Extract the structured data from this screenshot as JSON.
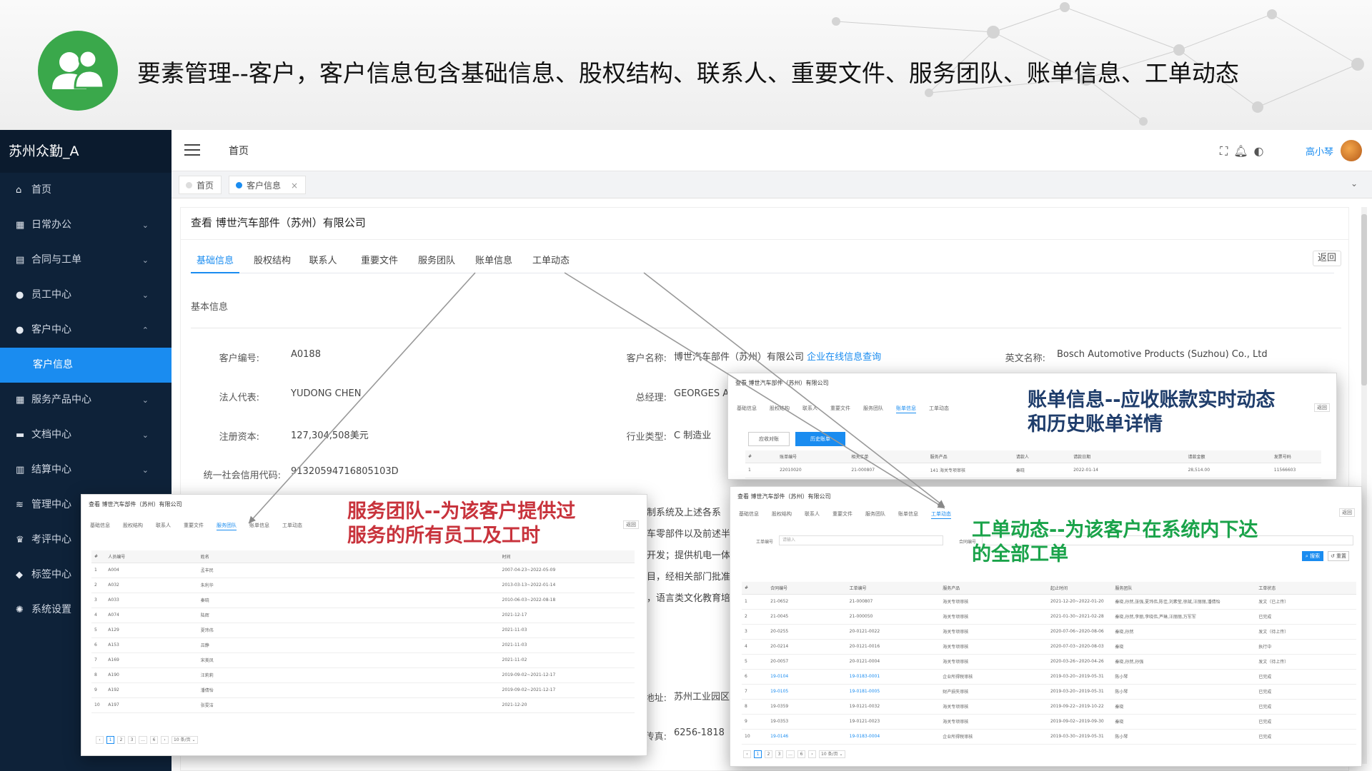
{
  "slide": {
    "title": "要素管理--客户，客户信息包含基础信息、股权结构、联系人、重要文件、服务团队、账单信息、工单动态",
    "logo_icon": "users-icon",
    "accent": "#3aa84b"
  },
  "app": {
    "brand": "苏州众勤_A",
    "home": "首页",
    "user": "高小琴",
    "icons": [
      "fullscreen-icon",
      "bell-icon",
      "theme-icon"
    ]
  },
  "sidebar": {
    "items": [
      {
        "icon": "home-icon",
        "glyph": "⌂",
        "label": "首页",
        "chevron": ""
      },
      {
        "icon": "briefcase-icon",
        "glyph": "▦",
        "label": "日常办公",
        "chevron": "⌄"
      },
      {
        "icon": "document-icon",
        "glyph": "▤",
        "label": "合同与工单",
        "chevron": "⌄"
      },
      {
        "icon": "user-icon",
        "glyph": "●",
        "label": "员工中心",
        "chevron": "⌄"
      },
      {
        "icon": "user-icon",
        "glyph": "●",
        "label": "客户中心",
        "chevron": "⌃"
      },
      {
        "icon": "",
        "glyph": "",
        "label": "客户信息",
        "chevron": ""
      },
      {
        "icon": "grid-icon",
        "glyph": "▦",
        "label": "服务产品中心",
        "chevron": "⌄"
      },
      {
        "icon": "folder-icon",
        "glyph": "▬",
        "label": "文档中心",
        "chevron": "⌄"
      },
      {
        "icon": "calculator-icon",
        "glyph": "▥",
        "label": "结算中心",
        "chevron": "⌄"
      },
      {
        "icon": "layers-icon",
        "glyph": "≋",
        "label": "管理中心",
        "chevron": ""
      },
      {
        "icon": "trophy-icon",
        "glyph": "♛",
        "label": "考评中心",
        "chevron": ""
      },
      {
        "icon": "tag-icon",
        "glyph": "◆",
        "label": "标签中心",
        "chevron": ""
      },
      {
        "icon": "gear-icon",
        "glyph": "✺",
        "label": "系统设置",
        "chevron": ""
      }
    ]
  },
  "page_tabs": [
    {
      "label": "首页",
      "close": ""
    },
    {
      "label": "客户信息",
      "close": "×"
    }
  ],
  "page": {
    "heading": "查看 博世汽车部件（苏州）有限公司",
    "back": "返回",
    "section": "基本信息",
    "tabs": [
      "基础信息",
      "股权结构",
      "联系人",
      "重要文件",
      "服务团队",
      "账单信息",
      "工单动态"
    ]
  },
  "fields": {
    "customer_no": {
      "label": "客户编号:",
      "value": "A0188"
    },
    "customer_name": {
      "label": "客户名称:",
      "value": "博世汽车部件（苏州）有限公司",
      "link": "企业在线信息查询"
    },
    "english_name": {
      "label": "英文名称:",
      "value": "Bosch Automotive Products (Suzhou) Co., Ltd"
    },
    "legal_rep": {
      "label": "法人代表:",
      "value": "YUDONG CHEN"
    },
    "gm": {
      "label": "总经理:",
      "value": "GEORGES A"
    },
    "capital": {
      "label": "注册资本:",
      "value": "127,304,508美元"
    },
    "industry": {
      "label": "行业类型:",
      "value": "C 制造业"
    },
    "credit_code": {
      "label": "统一社会信用代码:",
      "value": "91320594716805103D"
    },
    "address": {
      "label": "地址:",
      "value": "苏州工业园区"
    },
    "fax": {
      "label": "传真:",
      "value": "6256-1818"
    }
  },
  "scope_fragments": [
    "制系统及上述各系",
    "车零部件以及前述半",
    "开发；提供机电一体",
    "目，经相关部门批准",
    "，语言类文化教育培"
  ],
  "overlays": {
    "team": {
      "title": "查看 博世汽车部件（苏州）有限公司",
      "active_tab": 4,
      "back": "返回",
      "columns": [
        "#",
        "人员编号",
        "姓名",
        "时间"
      ],
      "rows": [
        [
          "1",
          "A004",
          "孟丰民",
          "2007-04-23~2022-05-09"
        ],
        [
          "2",
          "A032",
          "朱利华",
          "2013-03-13~2022-01-14"
        ],
        [
          "3",
          "A033",
          "秦晓",
          "2010-06-03~2022-08-18"
        ],
        [
          "4",
          "A074",
          "陆辉",
          "2021-12-17"
        ],
        [
          "5",
          "A129",
          "夏玮伟",
          "2021-11-03"
        ],
        [
          "6",
          "A153",
          "吕静",
          "2021-11-03"
        ],
        [
          "7",
          "A169",
          "宋美凤",
          "2021-11-02"
        ],
        [
          "8",
          "A190",
          "汪莉莉",
          "2019-09-02~2021-12-17"
        ],
        [
          "9",
          "A192",
          "潘倩怡",
          "2019-09-02~2021-12-17"
        ],
        [
          "10",
          "A197",
          "张雯洁",
          "2021-12-20"
        ]
      ],
      "pager": [
        "‹",
        "1",
        "2",
        "3",
        "…",
        "6",
        "›",
        "10 条/页 ⌄"
      ],
      "callout": [
        "服务团队--为该客户提供过",
        "服务的所有员工及工时"
      ],
      "callout_color": "#c8333c"
    },
    "bill": {
      "title": "查看 博世汽车部件（苏州）有限公司",
      "active_tab": 5,
      "back": "返回",
      "buttons": [
        "应收对账",
        "历史账单"
      ],
      "columns": [
        "#",
        "账单编号",
        "相关工单",
        "服务产品",
        "请款人",
        "请款日期",
        "请款金额",
        "发票号码"
      ],
      "rows": [
        [
          "1",
          "22010020",
          "21-000807",
          "141 海关专项审核",
          "秦晓",
          "2022-01-14",
          "28,514.00",
          "11566603"
        ]
      ],
      "callout": [
        "账单信息--应收账款实时动态",
        "和历史账单详情"
      ],
      "callout_color": "#1f3d6b"
    },
    "orders": {
      "title": "查看 博世汽车部件（苏州）有限公司",
      "active_tab": 6,
      "back": "返回",
      "filter_label": "工单编号",
      "filter_placeholder": "请输入",
      "filter_label2": "合同编号",
      "search": "⌕ 搜索",
      "reset": "↺ 重置",
      "columns": [
        "#",
        "合同编号",
        "工单编号",
        "服务产品",
        "起止时间",
        "服务团队",
        "工单状态"
      ],
      "rows": [
        [
          "1",
          "21-0652",
          "21-000807",
          "海关专项审核",
          "2021-12-20~2022-01-20",
          "秦晓,孙然,张强,夏玮伟,陈佳,刘素莹,徐斌,汪丽丽,潘倩怡",
          "发文（已上传）"
        ],
        [
          "2",
          "21-0045",
          "21-000050",
          "海关专项审核",
          "2021-01-30~2021-02-28",
          "秦晓,孙然,李丽,李晓伟,芦琳,汪丽丽,万军军",
          "已完成"
        ],
        [
          "3",
          "20-0255",
          "20-0121-0022",
          "海关专项审核",
          "2020-07-06~2020-08-06",
          "秦晓,孙然",
          "发文（待上传）"
        ],
        [
          "4",
          "20-0214",
          "20-0121-0016",
          "海关专项审核",
          "2020-07-03~2020-08-03",
          "秦晓",
          "执行中"
        ],
        [
          "5",
          "20-0057",
          "20-0121-0004",
          "海关专项审核",
          "2020-03-26~2020-04-26",
          "秦晓,孙然,孙强",
          "发文（待上传）"
        ],
        [
          "6",
          "19-0104",
          "19-0183-0001",
          "企业所得税审核",
          "2019-03-20~2019-05-31",
          "陈小琴",
          "已完成"
        ],
        [
          "7",
          "19-0105",
          "19-0181-0005",
          "财产损失审核",
          "2019-03-20~2019-05-31",
          "陈小琴",
          "已完成"
        ],
        [
          "8",
          "19-0359",
          "19-0121-0032",
          "海关专项审核",
          "2019-09-22~2019-10-22",
          "秦晓",
          "已完成"
        ],
        [
          "9",
          "19-0353",
          "19-0121-0023",
          "海关专项审核",
          "2019-09-02~2019-09-30",
          "秦晓",
          "已完成"
        ],
        [
          "10",
          "19-0146",
          "19-0183-0004",
          "企业所得税审核",
          "2019-03-30~2019-05-31",
          "陈小琴",
          "已完成"
        ]
      ],
      "pager": [
        "‹",
        "1",
        "2",
        "3",
        "…",
        "6",
        "›",
        "10 条/页 ⌄"
      ],
      "callout": [
        "工单动态--为该客户在系统内下达",
        "的全部工单"
      ],
      "callout_color": "#1aa34a"
    }
  }
}
